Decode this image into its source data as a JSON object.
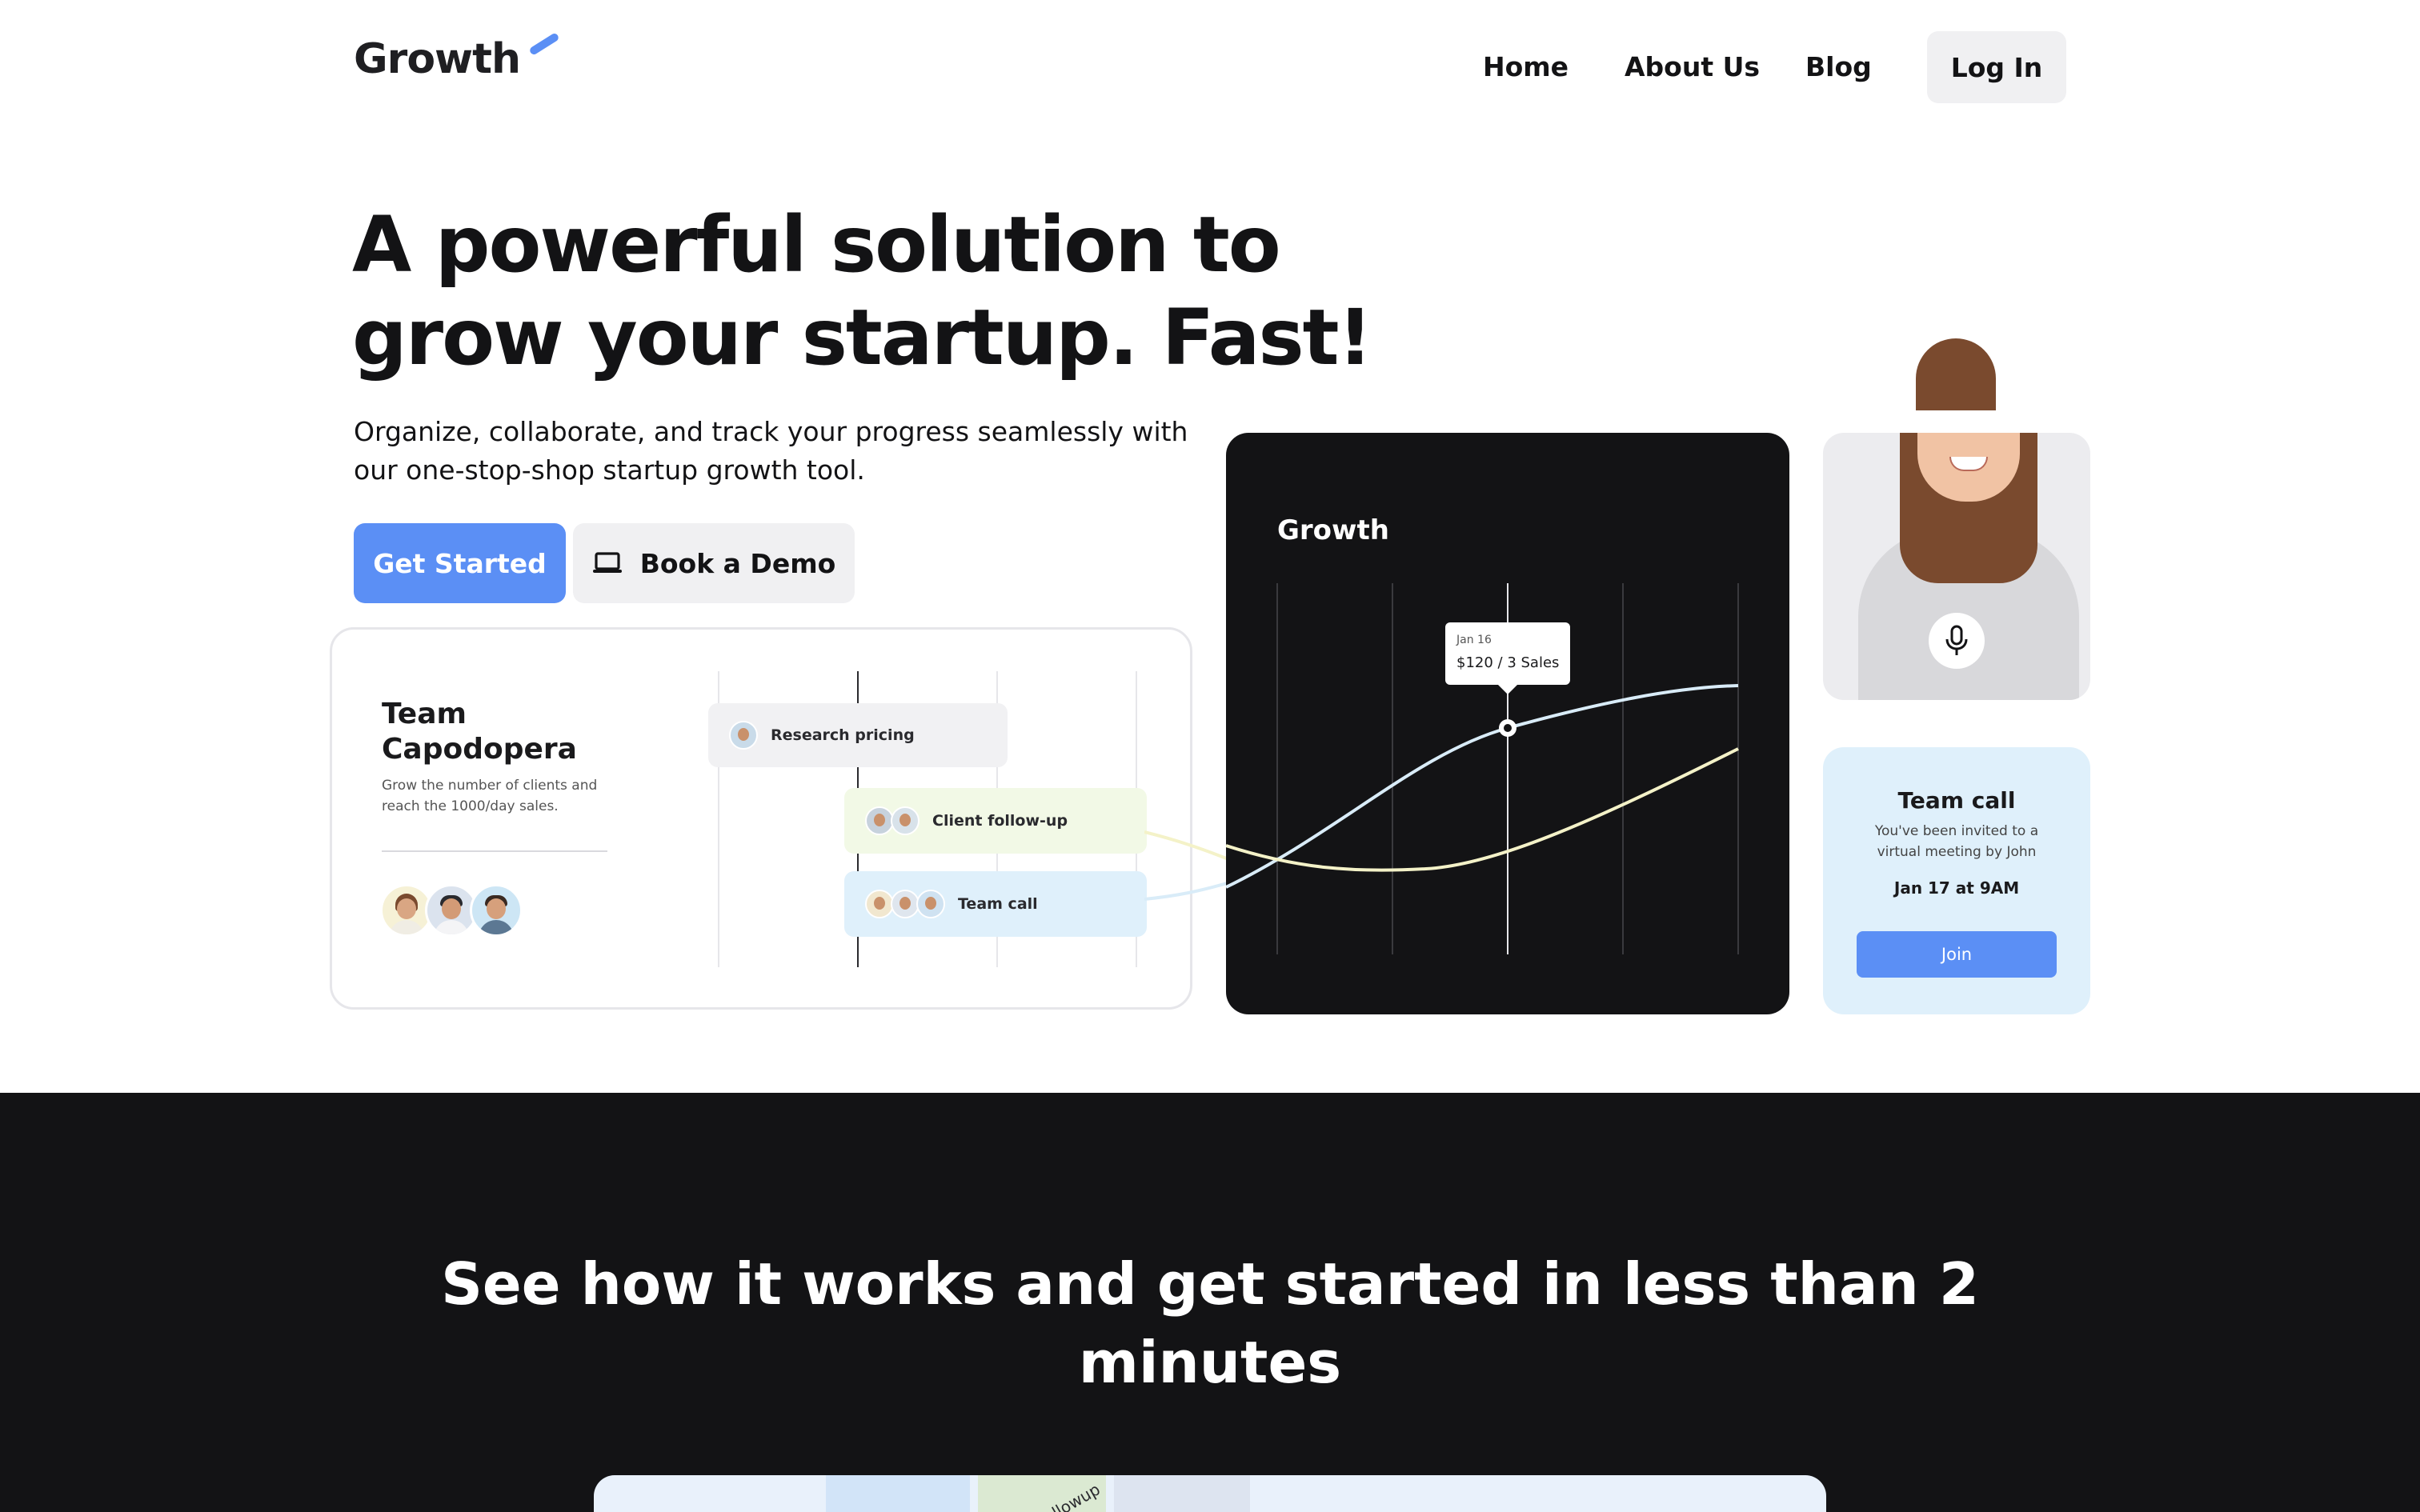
{
  "nav": {
    "logo": "Growth",
    "links": [
      "Home",
      "About Us",
      "Blog"
    ],
    "login": "Log In"
  },
  "hero": {
    "title": "A powerful solution to grow your startup. Fast!",
    "subtitle": "Organize, collaborate, and track your progress seamlessly with our one-stop-shop startup growth tool.",
    "primary_cta": "Get Started",
    "secondary_cta": "Book a Demo",
    "secondary_cta_icon": "laptop-icon"
  },
  "team_card": {
    "name": "Team Capodopera",
    "description": "Grow the number of clients and reach the 1000/day sales.",
    "tasks": [
      {
        "label": "Research pricing",
        "color": "#f1f1f3"
      },
      {
        "label": "Client follow-up",
        "color": "#f2f9e6"
      },
      {
        "label": "Team call",
        "color": "#dff0fb"
      }
    ]
  },
  "growth_chart": {
    "title": "Growth",
    "tooltip_date": "Jan 16",
    "tooltip_value": "$120 / 3 Sales",
    "line_colors": [
      "#d9ecf8",
      "#f4f2c8"
    ]
  },
  "person_card": {
    "icon": "microphone-icon"
  },
  "call_card": {
    "title": "Team call",
    "description": "You've been invited to a virtual meeting by John",
    "date": "Jan 17 at 9AM",
    "join": "Join"
  },
  "section2": {
    "heading": "See how it works and get started in less than 2 minutes",
    "preview_text": "llowup"
  },
  "colors": {
    "accent": "#5b8ff5",
    "dark": "#131315",
    "light_button": "#f0f0f2"
  }
}
